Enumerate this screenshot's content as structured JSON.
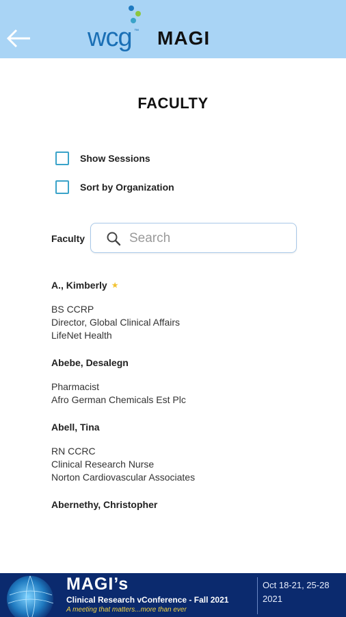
{
  "header": {
    "logo_text": "wcg",
    "logo_trademark": "™",
    "app_name": "MAGI",
    "back_icon": "arrow-left-icon",
    "background": "#a9d4f5"
  },
  "page": {
    "title": "FACULTY"
  },
  "options": {
    "show_sessions_label": "Show Sessions",
    "sort_by_org_label": "Sort by Organization"
  },
  "search": {
    "field_label": "Faculty",
    "placeholder": "Search",
    "value": ""
  },
  "faculty": [
    {
      "name": "A., Kimberly",
      "starred": true,
      "details": [
        "BS CCRP",
        "Director, Global Clinical Affairs",
        "LifeNet Health"
      ]
    },
    {
      "name": "Abebe, Desalegn",
      "starred": false,
      "details": [
        "Pharmacist",
        "Afro German Chemicals Est Plc"
      ]
    },
    {
      "name": "Abell, Tina",
      "starred": false,
      "details": [
        "RN CCRC",
        "Clinical Research Nurse",
        "Norton Cardiovascular Associates"
      ]
    },
    {
      "name": "Abernethy, Christopher",
      "starred": false,
      "details": []
    }
  ],
  "banner": {
    "title": "MAGI’s",
    "subtitle": "Clinical Research vConference - Fall 2021",
    "tagline": "A meeting that matters...more than ever",
    "dates_line1": "Oct 18-21, 25-28",
    "dates_line2": "2021",
    "background": "#0b2a6e",
    "tagline_color": "#f5d442"
  }
}
